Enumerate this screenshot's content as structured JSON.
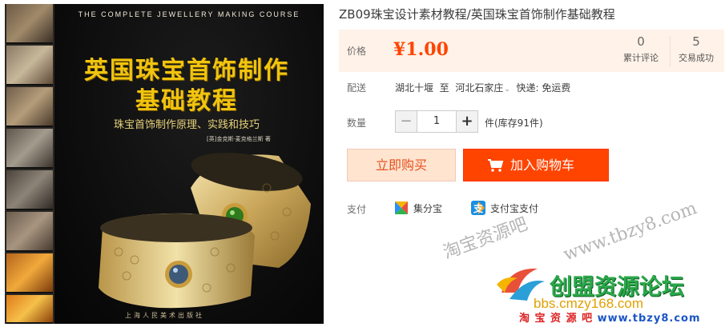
{
  "cover": {
    "series": "THE COMPLETE JEWELLERY MAKING COURSE",
    "title_line1": "英国珠宝首饰制作",
    "title_line2": "基础教程",
    "subtitle": "珠宝首饰制作原理、实践和技巧",
    "author": "[英]金克斯·麦克格兰斯 著",
    "publisher": "上海人民美术出版社"
  },
  "product": {
    "title": "ZB09珠宝设计素材教程/英国珠宝首饰制作基础教程",
    "price_label": "价格",
    "price": "¥1.00",
    "stats": [
      {
        "num": "0",
        "label": "累计评论"
      },
      {
        "num": "5",
        "label": "交易成功"
      }
    ],
    "delivery_label": "配送",
    "delivery_from": "湖北十堰",
    "delivery_to_word": "至",
    "delivery_to": "河北石家庄",
    "delivery_method": "快递: 免运费",
    "quantity_label": "数量",
    "quantity_minus": "−",
    "quantity_value": "1",
    "quantity_plus": "+",
    "stock": "件(库存91件)",
    "buy_now": "立即购买",
    "add_to_cart": "加入购物车",
    "payment_label": "支付",
    "payments": [
      {
        "icon": "jifenbao-icon",
        "label": "集分宝"
      },
      {
        "icon": "alipay-icon",
        "label": "支付宝支付"
      }
    ]
  },
  "watermarks": {
    "diagonal_cn": "淘宝资源吧",
    "diagonal_url": "www.tbzy8.com",
    "forum_name": "创盟资源论坛",
    "bbs": "bbs.cmzy168.com",
    "bottom_cn": "淘 宝 资 源 吧",
    "bottom_url": "www.tbzy8.com"
  },
  "colors": {
    "accent": "#ff4400",
    "price": "#ff4400",
    "buy_bg": "#ffe4d0",
    "panel_bg": "#fff2e8",
    "cover_title": "#f1c40f"
  }
}
